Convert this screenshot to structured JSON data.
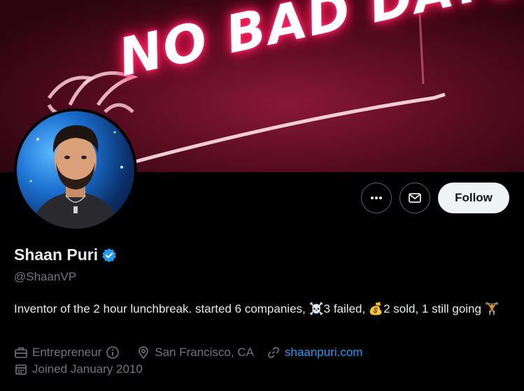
{
  "banner": {
    "neon_text": "NO BAD DAYS"
  },
  "profile": {
    "display_name": "Shaan Puri",
    "handle": "@ShaanVP",
    "bio": {
      "part1": "Inventor of the 2 hour lunchbreak. started 6 companies, ",
      "emoji1": "☠️",
      "part2": "3 failed, ",
      "emoji2": "💰",
      "part3": "2 sold, 1 still going ",
      "emoji3": "🏋️"
    },
    "category": "Entrepreneur",
    "location": "San Francisco, CA",
    "website": "shaanpuri.com",
    "joined": "Joined January 2010"
  },
  "actions": {
    "follow_label": "Follow"
  },
  "colors": {
    "background": "#000000",
    "text_primary": "#e7e9ea",
    "text_secondary": "#71767b",
    "link": "#1d9bf0",
    "verified": "#1d9bf0",
    "follow_bg": "#eff3f4"
  },
  "icons": [
    "more-icon",
    "mail-icon",
    "verified-badge-icon",
    "briefcase-icon",
    "info-icon",
    "location-icon",
    "link-icon",
    "calendar-icon"
  ]
}
